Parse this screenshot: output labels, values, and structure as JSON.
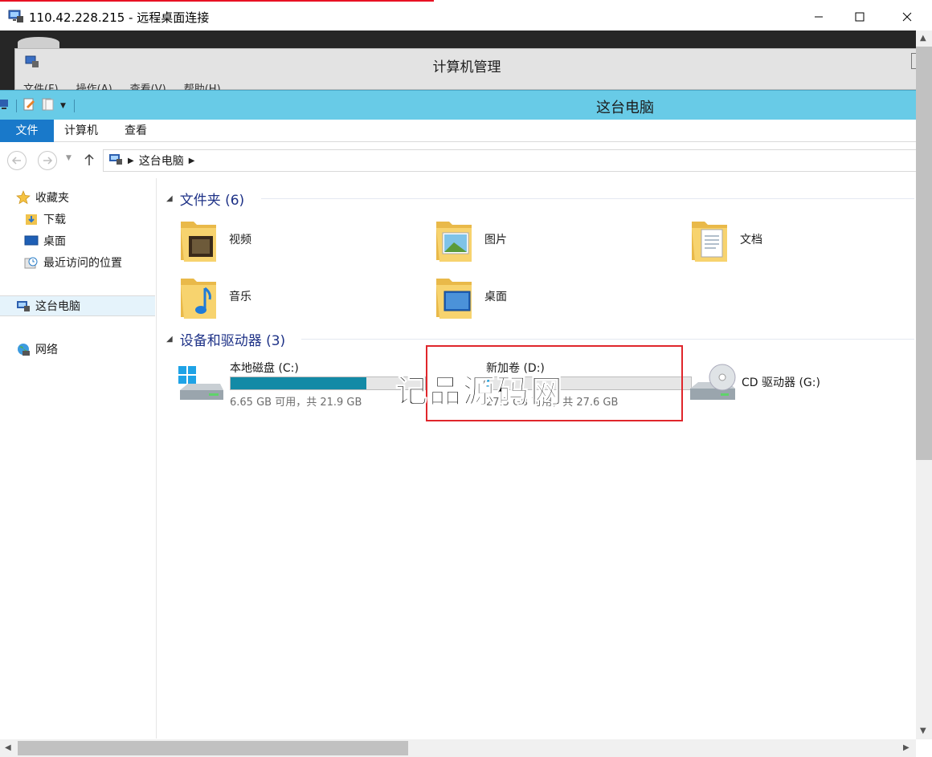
{
  "rdp": {
    "title": "110.42.228.215 - 远程桌面连接"
  },
  "computer_management": {
    "title": "计算机管理",
    "menu": [
      "文件(F)",
      "操作(A)",
      "查看(V)",
      "帮助(H)"
    ]
  },
  "explorer": {
    "title": "这台电脑",
    "tabs": {
      "file": "文件",
      "computer": "计算机",
      "view": "查看"
    },
    "address": {
      "crumb": "这台电脑"
    },
    "nav": {
      "favorites": "收藏夹",
      "downloads": "下载",
      "desktop": "桌面",
      "recent": "最近访问的位置",
      "this_pc": "这台电脑",
      "network": "网络"
    },
    "folders_header": "文件夹 (6)",
    "folders": {
      "videos": "视频",
      "pictures": "图片",
      "documents": "文档",
      "music": "音乐",
      "desktop": "桌面"
    },
    "devices_header": "设备和驱动器 (3)",
    "drives": {
      "c": {
        "name": "本地磁盘 (C:)",
        "info": "6.65 GB 可用，共 21.9 GB",
        "used_fraction": 0.7
      },
      "d": {
        "name": "新加卷 (D:)",
        "info": "27.5 GB 可用，共 27.6 GB",
        "used_fraction": 0.01
      },
      "g": {
        "name": "CD 驱动器 (G:)"
      }
    }
  },
  "watermark": {
    "text": "记品源码网"
  },
  "colors": {
    "accent": "#1979ca",
    "titlebar": "#68cbe7",
    "drive_fill_c": "#138aa6",
    "highlight": "#e0262b"
  }
}
